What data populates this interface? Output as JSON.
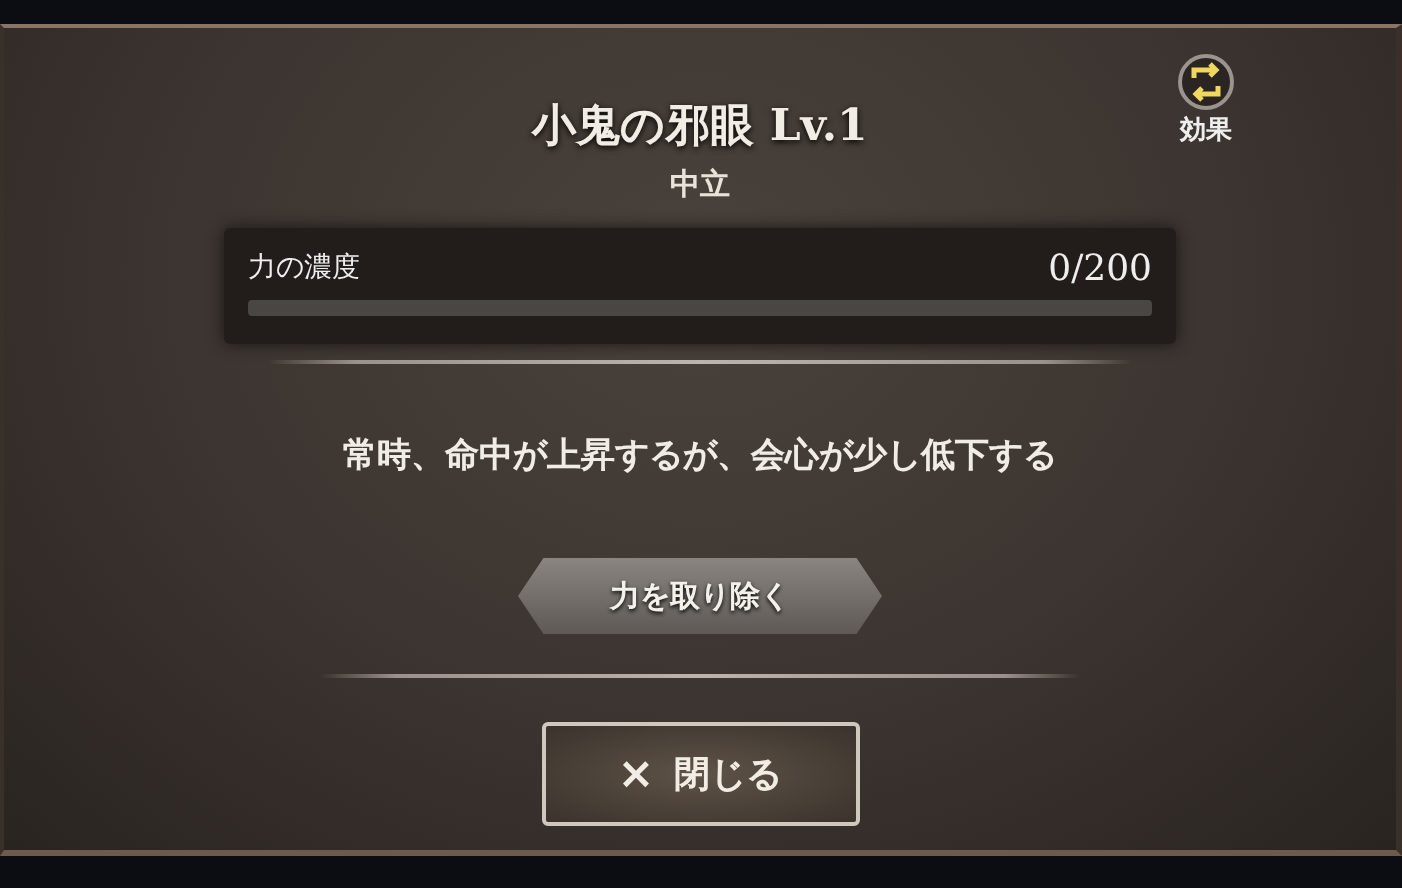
{
  "title": "小鬼の邪眼 Lv.1",
  "subtitle": "中立",
  "effect_button": {
    "label": "効果"
  },
  "gauge": {
    "label": "力の濃度",
    "reading": "0/200",
    "level": 0
  },
  "description": "常時、命中が上昇するが、会心が少し低下する",
  "remove_button": {
    "label": "力を取り除く"
  },
  "close_button": {
    "icon": "×",
    "label": "閉じる"
  }
}
